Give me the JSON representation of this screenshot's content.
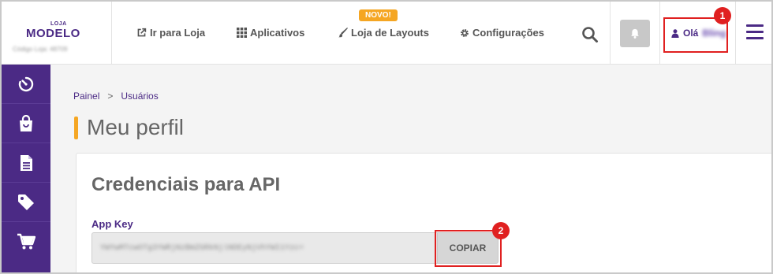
{
  "logo": {
    "small": "LOJA",
    "main": "MODELO",
    "store_code": "Código Loja: 48709"
  },
  "nav": {
    "store_link": "Ir para Loja",
    "apps": "Aplicativos",
    "layouts": "Loja de Layouts",
    "layouts_badge": "NOVO!",
    "settings": "Configurações"
  },
  "user": {
    "greeting": "Olá",
    "name": "Bling"
  },
  "sidebar": {
    "items": [
      {
        "icon": "dashboard-timer-icon"
      },
      {
        "icon": "shopping-bag-icon"
      },
      {
        "icon": "document-icon"
      },
      {
        "icon": "tag-icon"
      },
      {
        "icon": "cart-icon"
      }
    ]
  },
  "breadcrumb": {
    "root": "Painel",
    "separator": ">",
    "current": "Usuários"
  },
  "page": {
    "title": "Meu perfil"
  },
  "api_card": {
    "title": "Credenciais para API",
    "app_key_label": "App Key",
    "app_key_value": "YWYwMTcwOTg3YWRjNzBmZGRkNjlNDEyNjVhYWI1Yzc=",
    "copy_label": "COPIAR"
  },
  "annotations": [
    "1",
    "2"
  ],
  "colors": {
    "brand": "#4b2a85",
    "accent": "#f5a623",
    "annotation": "#e02020"
  }
}
